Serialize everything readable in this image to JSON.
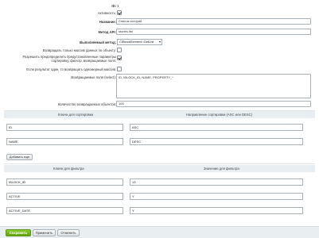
{
  "fields": {
    "id": {
      "label": "ID:",
      "value": "1"
    },
    "active": {
      "label": "Активность:",
      "checked": true
    },
    "name": {
      "label": "Название:",
      "value": "Список историй"
    },
    "method_api": {
      "label": "Метод API:",
      "value": "stories.list"
    },
    "method": {
      "label": "Выполняемый метод:",
      "value": "CIBlockElement::GetList"
    },
    "only_data": {
      "label": "Возвращать только массив данных по объекту:",
      "checked": false
    },
    "allow_params_1": "Разрешить предопределить предустановленные параметры",
    "allow_params_2": "сортировку, фильтр, возвращаемые поля:",
    "allow_params_checked": true,
    "single_obj": {
      "label": "Если результат один, то возвращать одномерный массив:",
      "checked": false
    },
    "return_fields": {
      "label": "Возвращаемые поля (select):",
      "value": "ID, IBLOCK_ID, NAME, PROPERTY_*"
    },
    "count": {
      "label": "Количество возвращаемых объектов:",
      "value": "100"
    }
  },
  "sort_table": {
    "col_key": "Ключи для сортировки",
    "col_dir": "Направление сортировки (ASC или DESC)",
    "rows": [
      {
        "key": "ID",
        "dir": "ASC"
      },
      {
        "key": "NAME",
        "dir": "DESC"
      }
    ],
    "add_label": "Добавить еще"
  },
  "filter_table": {
    "col_key": "Ключи для фильтра",
    "col_val": "Значение для фильтра",
    "rows": [
      {
        "key": "IBLOCK_ID",
        "val": "13"
      },
      {
        "key": "ACTIVE",
        "val": "Y"
      },
      {
        "key": "ACTIVE_DATE",
        "val": "Y"
      }
    ]
  },
  "footer": {
    "save": "Сохранить",
    "apply": "Применить",
    "cancel": "Отменить"
  },
  "colors": {
    "primary": "#62a30e",
    "header_bg": "#e9eef2",
    "footer_bg": "#e9eef1"
  }
}
